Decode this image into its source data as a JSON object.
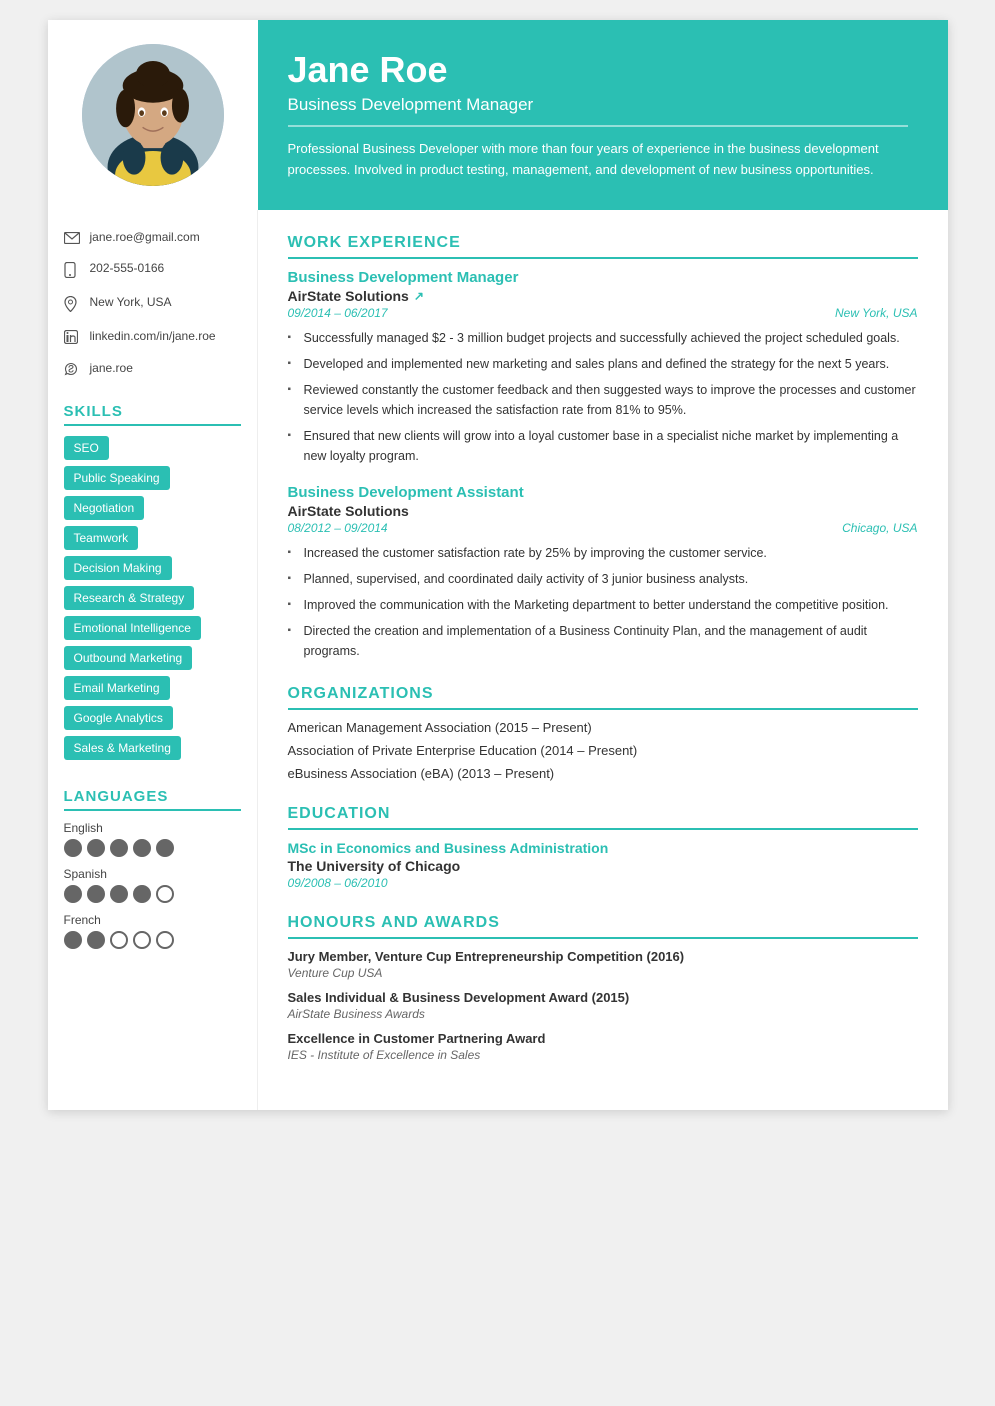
{
  "header": {
    "name": "Jane Roe",
    "title": "Business Development Manager",
    "bio": "Professional Business Developer with more than four years of experience in the business development processes. Involved in product testing, management, and development of new business opportunities."
  },
  "contact": {
    "email": "jane.roe@gmail.com",
    "phone": "202-555-0166",
    "location": "New York, USA",
    "linkedin": "linkedin.com/in/jane.roe",
    "skype": "jane.roe"
  },
  "skills": {
    "title": "SKILLS",
    "items": [
      "SEO",
      "Public Speaking",
      "Negotiation",
      "Teamwork",
      "Decision Making",
      "Research & Strategy",
      "Emotional Intelligence",
      "Outbound Marketing",
      "Email Marketing",
      "Google Analytics",
      "Sales & Marketing"
    ]
  },
  "languages": {
    "title": "LANGUAGES",
    "items": [
      {
        "name": "English",
        "filled": 5,
        "total": 5
      },
      {
        "name": "Spanish",
        "filled": 4,
        "total": 5
      },
      {
        "name": "French",
        "filled": 2,
        "total": 5
      }
    ]
  },
  "work_experience": {
    "title": "WORK EXPERIENCE",
    "jobs": [
      {
        "title": "Business Development Manager",
        "company": "AirState Solutions",
        "has_link": true,
        "dates": "09/2014 – 06/2017",
        "location": "New York, USA",
        "bullets": [
          "Successfully managed $2 - 3 million budget projects and successfully achieved the project scheduled goals.",
          "Developed and implemented new marketing and sales plans and defined the strategy for the next 5 years.",
          "Reviewed constantly the customer feedback and then suggested ways to improve the processes and customer service levels which increased the satisfaction rate from 81% to 95%.",
          "Ensured that new clients will grow into a loyal customer base in a specialist niche market by implementing a new loyalty program."
        ]
      },
      {
        "title": "Business Development Assistant",
        "company": "AirState Solutions",
        "has_link": false,
        "dates": "08/2012 – 09/2014",
        "location": "Chicago, USA",
        "bullets": [
          "Increased the customer satisfaction rate by 25% by improving the customer service.",
          "Planned, supervised, and coordinated daily activity of 3 junior business analysts.",
          "Improved the communication with the Marketing department to better understand the competitive position.",
          "Directed the creation and implementation of a Business Continuity Plan, and the management of audit programs."
        ]
      }
    ]
  },
  "organizations": {
    "title": "ORGANIZATIONS",
    "items": [
      "American Management Association (2015 – Present)",
      "Association of Private Enterprise Education (2014 – Present)",
      "eBusiness Association (eBA) (2013 – Present)"
    ]
  },
  "education": {
    "title": "EDUCATION",
    "items": [
      {
        "degree": "MSc in Economics and Business Administration",
        "school": "The University of Chicago",
        "dates": "09/2008 – 06/2010"
      }
    ]
  },
  "honours": {
    "title": "HONOURS AND AWARDS",
    "items": [
      {
        "title": "Jury Member, Venture Cup Entrepreneurship Competition (2016)",
        "org": "Venture Cup USA"
      },
      {
        "title": "Sales Individual & Business Development Award (2015)",
        "org": "AirState Business Awards"
      },
      {
        "title": "Excellence in Customer Partnering Award",
        "org": "IES - Institute of Excellence in Sales"
      }
    ]
  }
}
